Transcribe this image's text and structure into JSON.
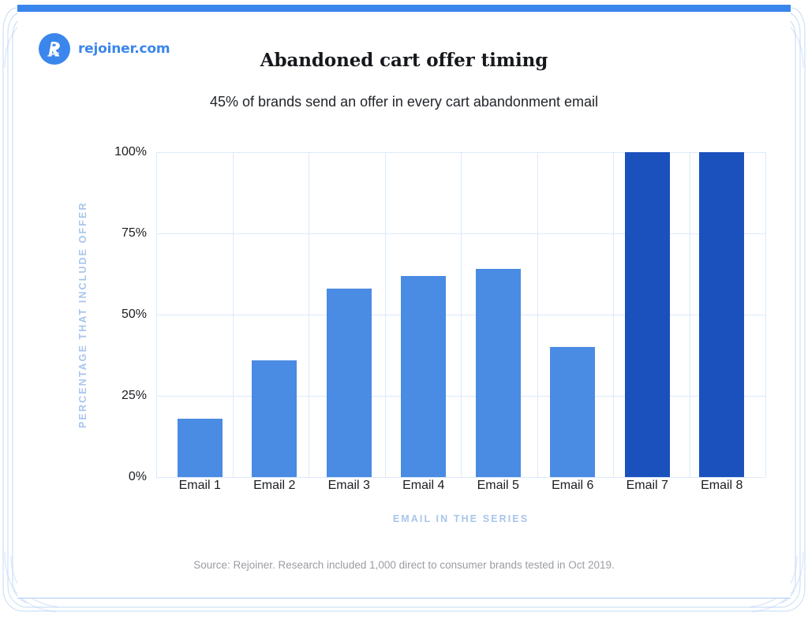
{
  "brand": {
    "logo_icon": "rejoiner-r-logo-icon",
    "name": "rejoiner.com",
    "color": "#3b86ec"
  },
  "header": {
    "title": "Abandoned cart offer timing",
    "subtitle": "45% of brands send an offer in every cart abandonment email"
  },
  "footer": {
    "source": "Source: Rejoiner. Research included 1,000 direct to consumer brands tested in Oct 2019."
  },
  "colors": {
    "bar_default": "#4a8be3",
    "bar_accent": "#1a51bd",
    "gridline": "#dce9fb",
    "axis_title": "#a8c6ec",
    "card_top_border": "#3b86ec",
    "tick_label": "#1b1d21",
    "source_text": "#9a9ca1"
  },
  "chart_data": {
    "type": "bar",
    "title": "Abandoned cart offer timing",
    "subtitle": "45% of brands send an offer in every cart abandonment email",
    "xlabel": "EMAIL IN THE SERIES",
    "ylabel": "PERCENTAGE THAT INCLUDE OFFER",
    "categories": [
      "Email 1",
      "Email 2",
      "Email 3",
      "Email 4",
      "Email 5",
      "Email 6",
      "Email 7",
      "Email 8"
    ],
    "values": [
      18,
      36,
      58,
      62,
      64,
      40,
      100,
      100
    ],
    "bar_colors": [
      "#4a8be3",
      "#4a8be3",
      "#4a8be3",
      "#4a8be3",
      "#4a8be3",
      "#4a8be3",
      "#1a51bd",
      "#1a51bd"
    ],
    "ylim": [
      0,
      100
    ],
    "yticks": [
      0,
      25,
      50,
      75,
      100
    ],
    "ytick_labels": [
      "0%",
      "25%",
      "50%",
      "75%",
      "100%"
    ],
    "grid": true,
    "legend": "none"
  }
}
